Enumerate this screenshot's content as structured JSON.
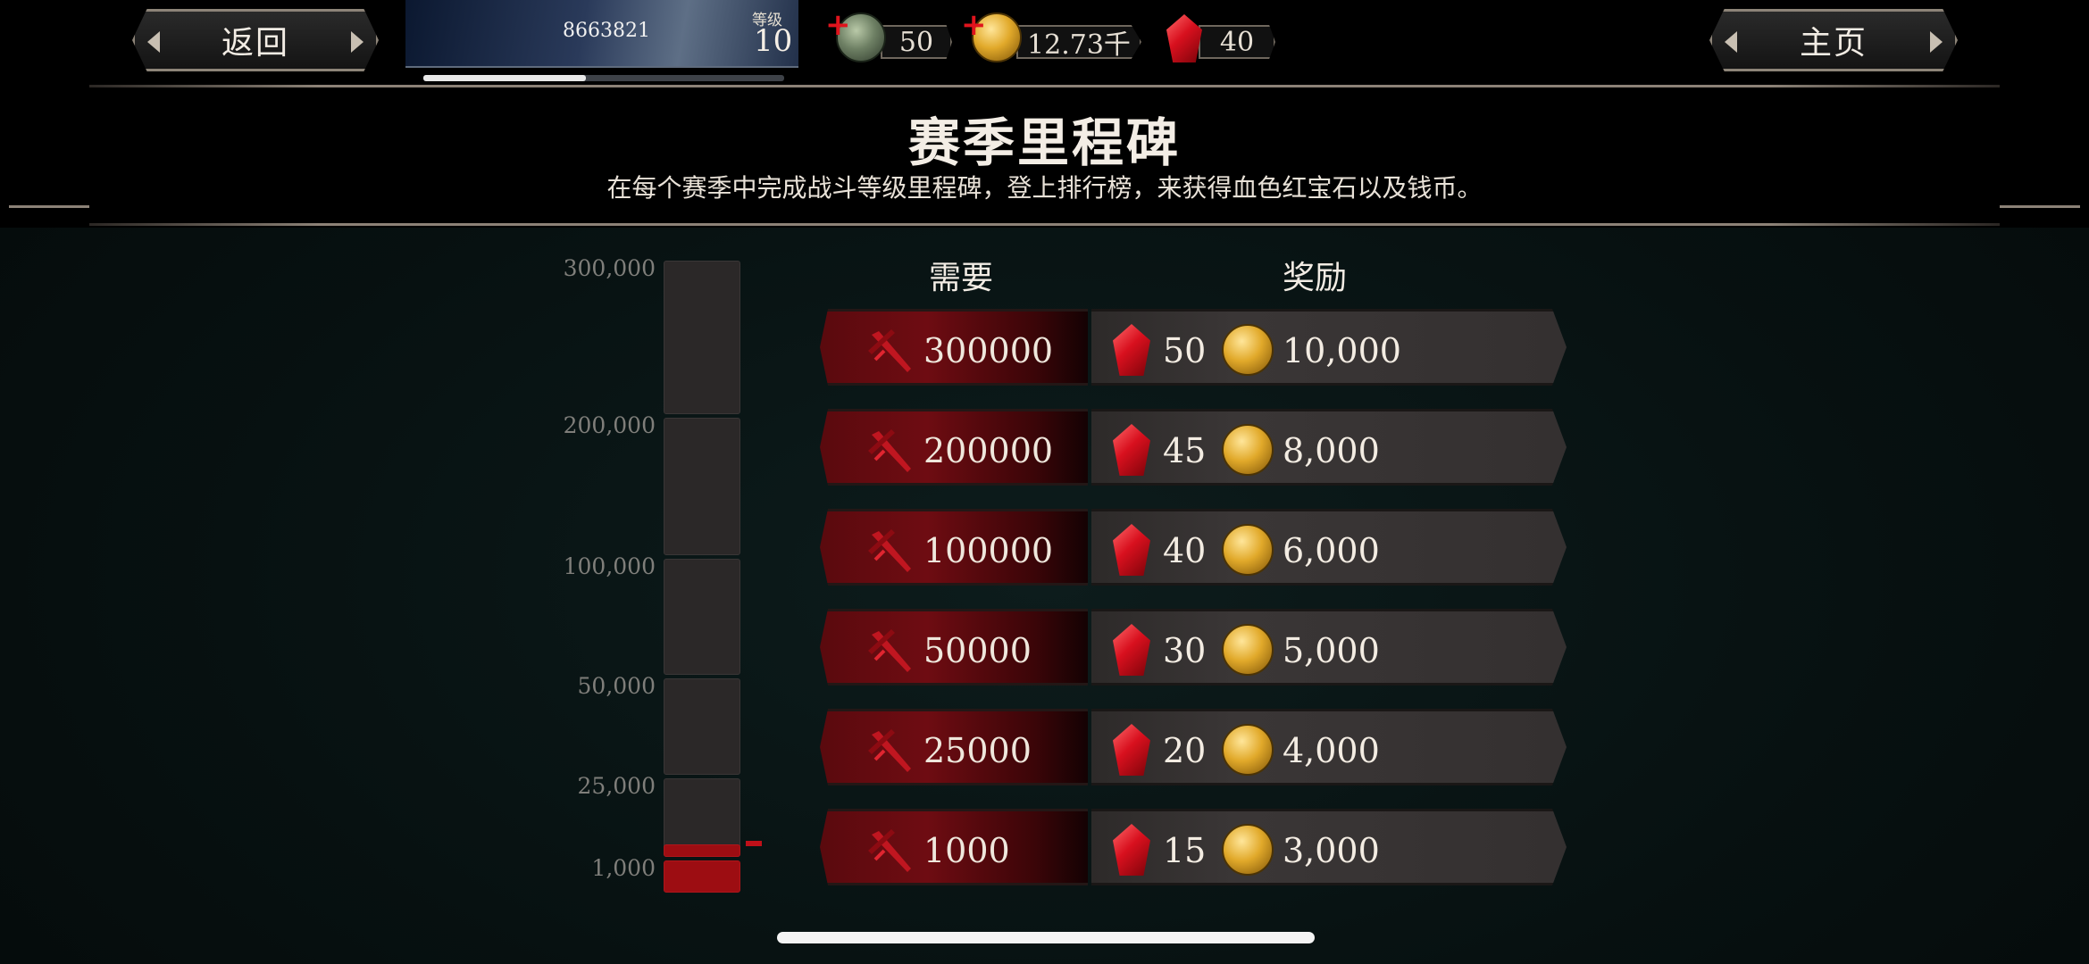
{
  "topbar": {
    "back_label": "返回",
    "home_label": "主页",
    "player": {
      "id": "8663821",
      "level_label": "等级",
      "level": "10",
      "xp_progress": 0.45
    },
    "currencies": [
      {
        "icon": "skull-icon",
        "value": "50"
      },
      {
        "icon": "gold-coin-icon",
        "value": "12.73千"
      },
      {
        "icon": "ruby-icon",
        "value": "40"
      }
    ]
  },
  "header": {
    "title": "赛季里程碑",
    "subtitle": "在每个赛季中完成战斗等级里程碑，登上排行榜，来获得血色红宝石以及钱币。"
  },
  "meter": {
    "ticks": [
      "300,000",
      "200,000",
      "100,000",
      "50,000",
      "25,000",
      "1,000"
    ]
  },
  "table": {
    "col_required": "需要",
    "col_reward": "奖励",
    "rows": [
      {
        "required": "300000",
        "rubies": "50",
        "coins": "10,000"
      },
      {
        "required": "200000",
        "rubies": "45",
        "coins": "8,000"
      },
      {
        "required": "100000",
        "rubies": "40",
        "coins": "6,000"
      },
      {
        "required": "50000",
        "rubies": "30",
        "coins": "5,000"
      },
      {
        "required": "25000",
        "rubies": "20",
        "coins": "4,000"
      },
      {
        "required": "1000",
        "rubies": "15",
        "coins": "3,000"
      }
    ]
  },
  "colors": {
    "accent_red": "#9d0d12",
    "frame": "#8d8478",
    "background": "#071111"
  }
}
